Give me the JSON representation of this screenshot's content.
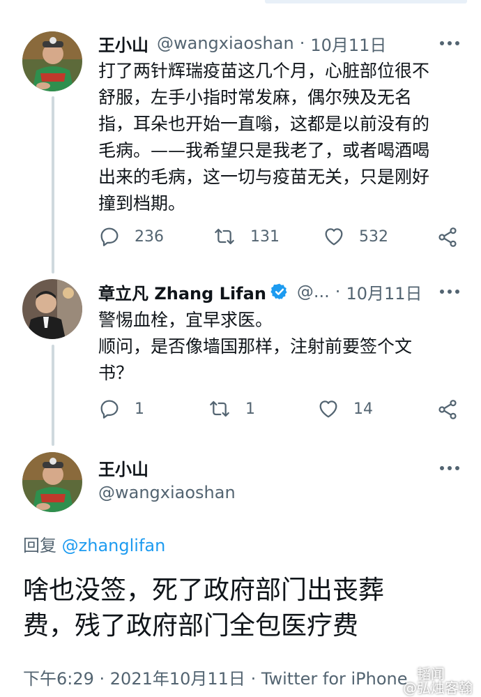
{
  "tweet1": {
    "name": "王小山",
    "handle": "@wangxiaoshan",
    "dot": "·",
    "date": "10月11日",
    "lines": [
      "打了两针辉瑞疫苗这几个月，心脏部位很不",
      "舒服，左手小指时常发麻，偶尔殃及无名",
      "指，耳朵也开始一直嗡，这都是以前没有的",
      "毛病。——我希望只是我老了，或者喝酒喝",
      "出来的毛病，这一切与疫苗无关，只是刚好",
      "撞到档期。"
    ],
    "replies": "236",
    "retweets": "131",
    "likes": "532"
  },
  "tweet2": {
    "name": "章立凡 Zhang Lifan",
    "handle": "@...",
    "dot": "·",
    "date": "10月11日",
    "lines": [
      "警惕血栓，宜早求医。",
      "顺问，是否像墙国那样，注射前要签个文",
      "书？"
    ],
    "replies": "1",
    "retweets": "1",
    "likes": "14"
  },
  "tweet3": {
    "name": "王小山",
    "handle": "@wangxiaoshan",
    "reply_prefix": "回复",
    "reply_to": "@zhanglifan",
    "lines": [
      "啥也没签，死了政府部门出丧葬",
      "费，残了政府部门全包医疗费"
    ],
    "footer": "下午6:29 · 2021年10月11日 · Twitter for iPhone"
  },
  "watermark": {
    "top": "韬闻",
    "bottom": "@弘烛客翰"
  },
  "colors": {
    "text": "#0f1419",
    "secondary": "#536471",
    "link": "#1d9bf0",
    "thread_line": "#cfd9de"
  },
  "icons": [
    "reply-icon",
    "retweet-icon",
    "like-icon",
    "share-icon",
    "more-icon",
    "verified-badge-icon"
  ]
}
